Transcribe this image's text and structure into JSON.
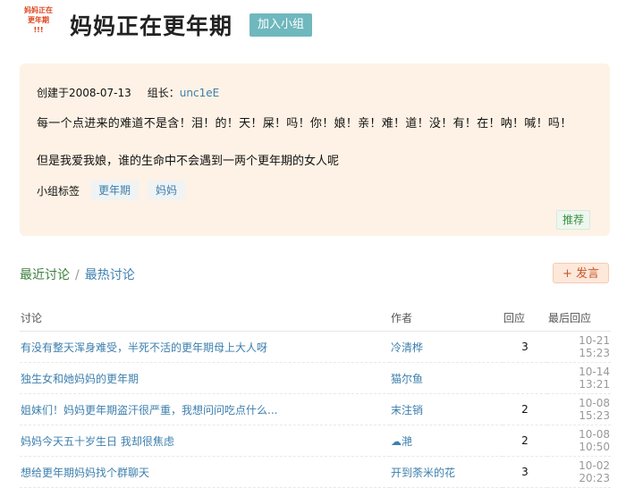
{
  "group": {
    "logo_lines": [
      "妈妈正在",
      "更年期",
      "!!!"
    ],
    "title": "妈妈正在更年期",
    "join_label": "加入小组"
  },
  "info": {
    "created_label": "创建于2008-07-13",
    "owner_label": "组长：",
    "owner_name": "unc1eE",
    "description_line1": "每一个点进来的难道不是含！泪！的！天！屎！吗！你！娘！亲！难！道！没！有！在！呐！喊！吗！",
    "description_line2": "但是我爱我娘，谁的生命中不会遇到一两个更年期的女人呢",
    "tags_label": "小组标签",
    "tags": [
      "更年期",
      "妈妈"
    ],
    "recommend_label": "推荐"
  },
  "discussion": {
    "tab_recent": "最近讨论",
    "tab_separator": "/",
    "tab_hot": "最热讨论",
    "post_icon": "+",
    "post_label": "发言",
    "headers": {
      "title": "讨论",
      "author": "作者",
      "replies": "回应",
      "last_reply": "最后回应"
    },
    "rows": [
      {
        "title": "有没有整天浑身难受，半死不活的更年期母上大人呀",
        "author": "冷清桦",
        "replies": "3",
        "time": "10-21 15:23"
      },
      {
        "title": "独生女和她妈妈的更年期",
        "author": "猫尔鱼",
        "replies": "",
        "time": "10-14 13:21"
      },
      {
        "title": "姐妹们！妈妈更年期盗汗很严重，我想问问吃点什么...",
        "author": "末注销",
        "replies": "2",
        "time": "10-08 15:23"
      },
      {
        "title": "妈妈今天五十岁生日 我却很焦虑",
        "author": "☁滟",
        "replies": "2",
        "time": "10-08 10:50"
      },
      {
        "title": "想给更年期妈妈找个群聊天",
        "author": "开到荼米的花",
        "replies": "3",
        "time": "10-02 20:23"
      }
    ]
  }
}
